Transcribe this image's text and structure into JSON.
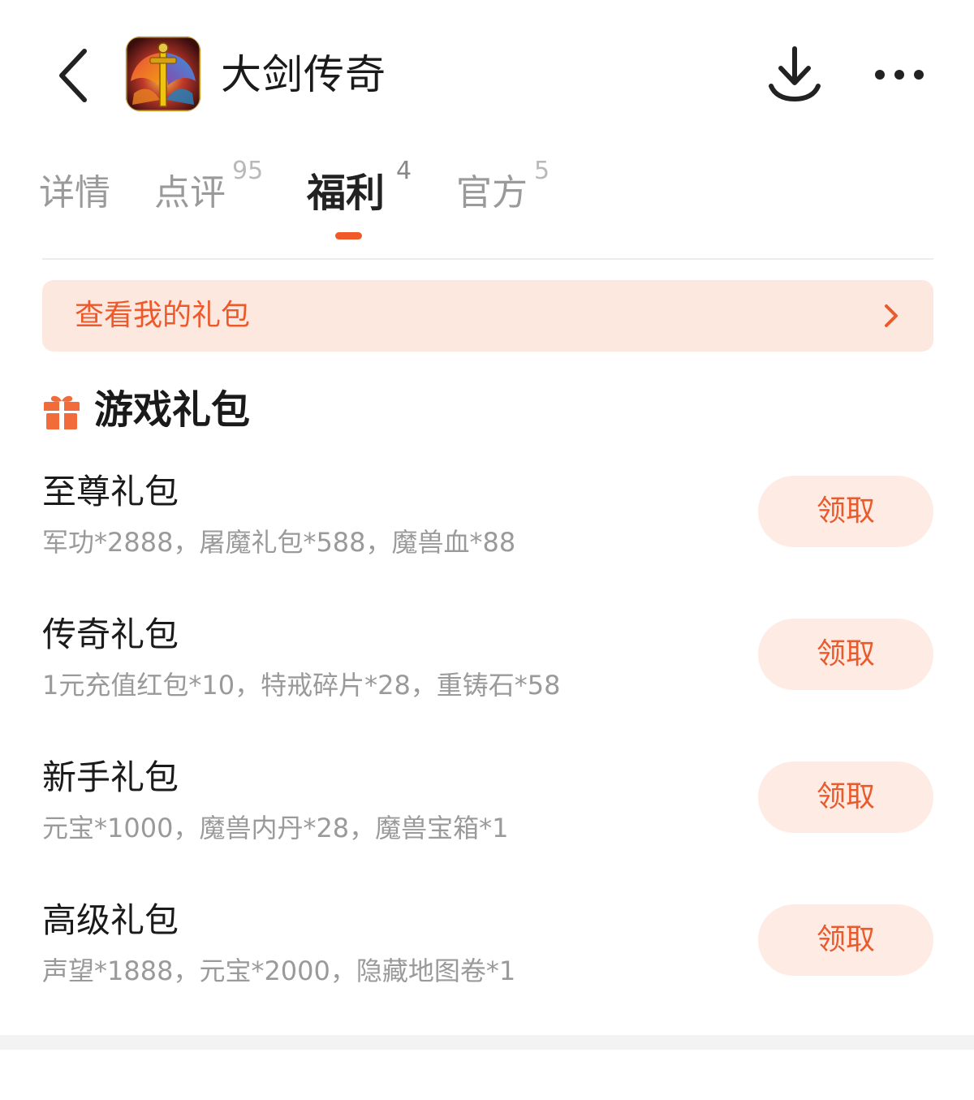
{
  "header": {
    "back_icon": "chevron-left-icon",
    "app_icon": "game-app-icon",
    "title": "大剑传奇",
    "download_icon": "download-icon",
    "more_icon": "more-dots-icon"
  },
  "tabs": [
    {
      "label": "详情",
      "count": ""
    },
    {
      "label": "点评",
      "count": "95"
    },
    {
      "label": "福利",
      "count": "4",
      "active": true
    },
    {
      "label": "官方",
      "count": "5"
    }
  ],
  "banner": {
    "label": "查看我的礼包",
    "icon": "chevron-right-icon"
  },
  "section": {
    "icon": "gift-icon",
    "title": "游戏礼包"
  },
  "gifts": [
    {
      "name": "至尊礼包",
      "desc": "军功*2888，屠魔礼包*588，魔兽血*88",
      "button": "领取"
    },
    {
      "name": "传奇礼包",
      "desc": "1元充值红包*10，特戒碎片*28，重铸石*58",
      "button": "领取"
    },
    {
      "name": "新手礼包",
      "desc": "元宝*1000，魔兽内丹*28，魔兽宝箱*1",
      "button": "领取"
    },
    {
      "name": "高级礼包",
      "desc": "声望*1888，元宝*2000，隐藏地图卷*1",
      "button": "领取"
    }
  ],
  "colors": {
    "accent": "#ec5a2c",
    "accent_bg": "#fde8e0",
    "text_primary": "#1a1a1a",
    "text_secondary": "#9a9a9a"
  }
}
